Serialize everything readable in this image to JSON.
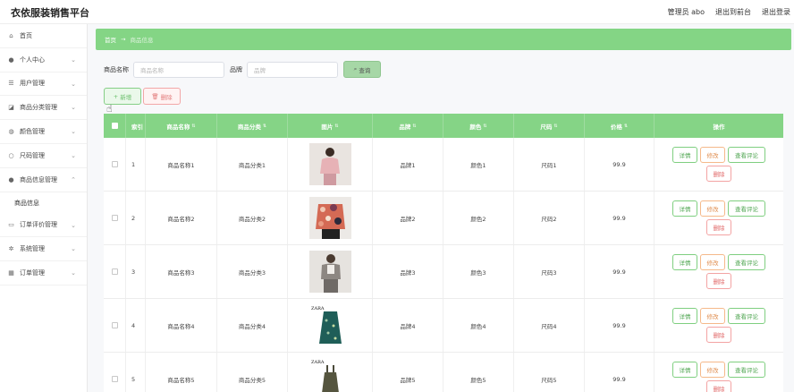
{
  "header": {
    "title": "衣依服装销售平台",
    "admin_label": "管理员 abo",
    "front_label": "退出到前台",
    "logout_label": "退出登录"
  },
  "sidebar": {
    "items": [
      {
        "label": "首页",
        "icon": "home-icon"
      },
      {
        "label": "个人中心",
        "icon": "user-icon"
      },
      {
        "label": "用户管理",
        "icon": "list-icon"
      },
      {
        "label": "商品分类管理",
        "icon": "tag-icon"
      },
      {
        "label": "颜色管理",
        "icon": "palette-icon"
      },
      {
        "label": "尺码管理",
        "icon": "ruler-icon"
      },
      {
        "label": "商品信息管理",
        "icon": "user-icon",
        "sub": "商品信息"
      },
      {
        "label": "订单评价管理",
        "icon": "comment-icon"
      },
      {
        "label": "系统管理",
        "icon": "gear-icon"
      },
      {
        "label": "订单管理",
        "icon": "grid-icon"
      }
    ]
  },
  "breadcrumb": {
    "home": "首页",
    "separator": "→",
    "current": "商品信息"
  },
  "search": {
    "name_label": "商品名称",
    "name_placeholder": "商品名称",
    "brand_label": "品牌",
    "brand_placeholder": "品牌",
    "query_label": "查询"
  },
  "toolbar": {
    "add_label": "新增",
    "delete_label": "删除"
  },
  "table": {
    "headers": {
      "index": "索引",
      "name": "商品名称",
      "category": "商品分类",
      "picture": "图片",
      "brand": "品牌",
      "color": "颜色",
      "size": "尺码",
      "price": "价格",
      "ops": "操作"
    },
    "op_labels": {
      "detail": "详情",
      "edit": "修改",
      "review": "查看评论",
      "delete": "删除"
    },
    "rows": [
      {
        "index": "1",
        "name": "商品名称1",
        "category": "商品分类1",
        "brand": "品牌1",
        "color": "颜色1",
        "size": "尺码1",
        "price": "99.9",
        "image": "model-pink-sweater"
      },
      {
        "index": "2",
        "name": "商品名称2",
        "category": "商品分类2",
        "brand": "品牌2",
        "color": "颜色2",
        "size": "尺码2",
        "price": "99.9",
        "image": "floral-jacket"
      },
      {
        "index": "3",
        "name": "商品名称3",
        "category": "商品分类3",
        "brand": "品牌3",
        "color": "颜色3",
        "size": "尺码3",
        "price": "99.9",
        "image": "model-grey-outfit"
      },
      {
        "index": "4",
        "name": "商品名称4",
        "category": "商品分类4",
        "brand": "品牌4",
        "color": "颜色4",
        "size": "尺码4",
        "price": "99.9",
        "image": "green-floral-dress",
        "brand_mark": "ZARA"
      },
      {
        "index": "5",
        "name": "商品名称5",
        "category": "商品分类5",
        "brand": "品牌5",
        "color": "颜色5",
        "size": "尺码5",
        "price": "99.9",
        "image": "olive-pinafore-dress",
        "brand_mark": "ZARA"
      }
    ]
  },
  "colors": {
    "accent": "#85d486",
    "delete": "#e06767",
    "edit": "#e08d4e"
  }
}
